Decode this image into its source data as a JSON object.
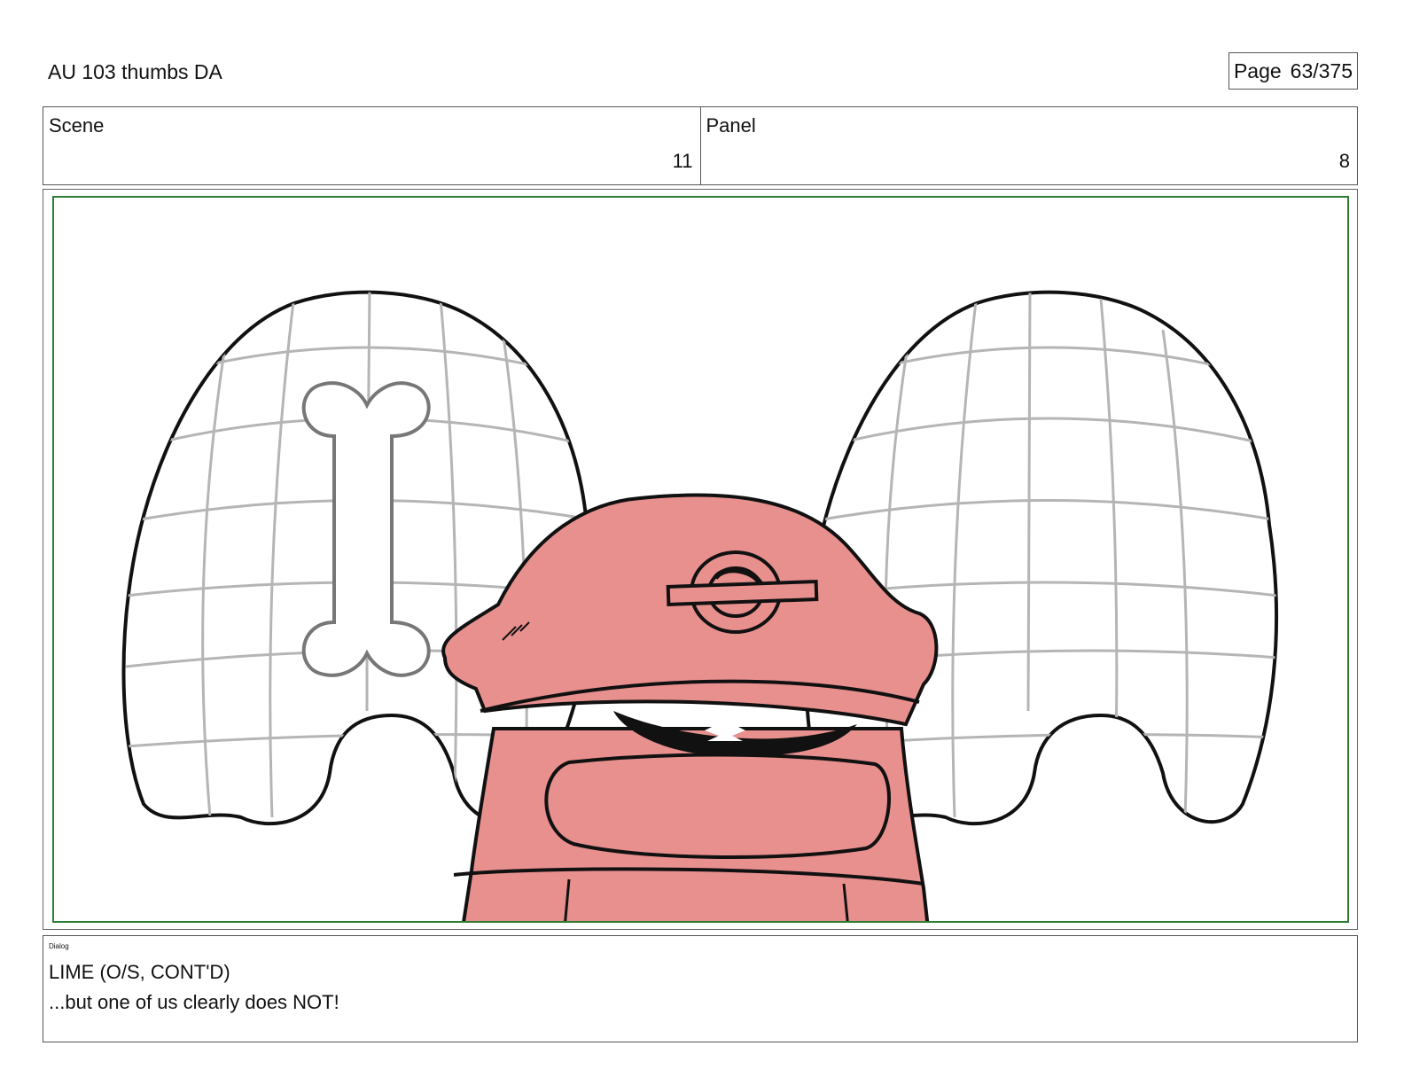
{
  "header": {
    "title": "AU 103 thumbs DA",
    "page_label": "Page",
    "page_value": "63/375"
  },
  "scene": {
    "label": "Scene",
    "value": "11"
  },
  "panel": {
    "label": "Panel",
    "value": "8"
  },
  "dialog": {
    "label": "Dialog",
    "line1": "LIME (O/S, CONT'D)",
    "line2": "...but one of us clearly does NOT!"
  },
  "colors": {
    "frame": "#2e7d32",
    "character_fill": "#e8908e",
    "grid": "#b5b5b5",
    "ink": "#111111"
  }
}
